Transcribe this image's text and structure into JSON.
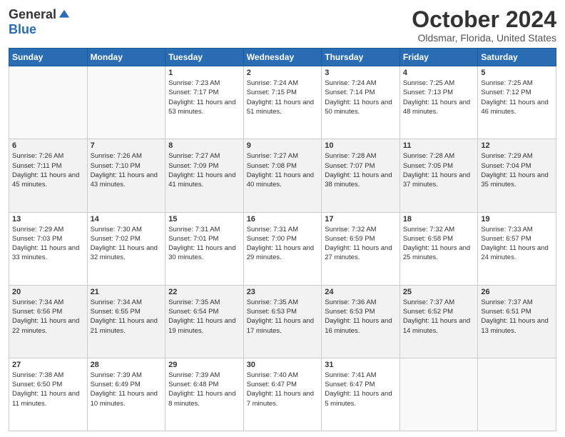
{
  "header": {
    "logo_general": "General",
    "logo_blue": "Blue",
    "month": "October 2024",
    "location": "Oldsmar, Florida, United States"
  },
  "days_of_week": [
    "Sunday",
    "Monday",
    "Tuesday",
    "Wednesday",
    "Thursday",
    "Friday",
    "Saturday"
  ],
  "weeks": [
    [
      {
        "day": "",
        "sunrise": "",
        "sunset": "",
        "daylight": ""
      },
      {
        "day": "",
        "sunrise": "",
        "sunset": "",
        "daylight": ""
      },
      {
        "day": "1",
        "sunrise": "Sunrise: 7:23 AM",
        "sunset": "Sunset: 7:17 PM",
        "daylight": "Daylight: 11 hours and 53 minutes."
      },
      {
        "day": "2",
        "sunrise": "Sunrise: 7:24 AM",
        "sunset": "Sunset: 7:15 PM",
        "daylight": "Daylight: 11 hours and 51 minutes."
      },
      {
        "day": "3",
        "sunrise": "Sunrise: 7:24 AM",
        "sunset": "Sunset: 7:14 PM",
        "daylight": "Daylight: 11 hours and 50 minutes."
      },
      {
        "day": "4",
        "sunrise": "Sunrise: 7:25 AM",
        "sunset": "Sunset: 7:13 PM",
        "daylight": "Daylight: 11 hours and 48 minutes."
      },
      {
        "day": "5",
        "sunrise": "Sunrise: 7:25 AM",
        "sunset": "Sunset: 7:12 PM",
        "daylight": "Daylight: 11 hours and 46 minutes."
      }
    ],
    [
      {
        "day": "6",
        "sunrise": "Sunrise: 7:26 AM",
        "sunset": "Sunset: 7:11 PM",
        "daylight": "Daylight: 11 hours and 45 minutes."
      },
      {
        "day": "7",
        "sunrise": "Sunrise: 7:26 AM",
        "sunset": "Sunset: 7:10 PM",
        "daylight": "Daylight: 11 hours and 43 minutes."
      },
      {
        "day": "8",
        "sunrise": "Sunrise: 7:27 AM",
        "sunset": "Sunset: 7:09 PM",
        "daylight": "Daylight: 11 hours and 41 minutes."
      },
      {
        "day": "9",
        "sunrise": "Sunrise: 7:27 AM",
        "sunset": "Sunset: 7:08 PM",
        "daylight": "Daylight: 11 hours and 40 minutes."
      },
      {
        "day": "10",
        "sunrise": "Sunrise: 7:28 AM",
        "sunset": "Sunset: 7:07 PM",
        "daylight": "Daylight: 11 hours and 38 minutes."
      },
      {
        "day": "11",
        "sunrise": "Sunrise: 7:28 AM",
        "sunset": "Sunset: 7:05 PM",
        "daylight": "Daylight: 11 hours and 37 minutes."
      },
      {
        "day": "12",
        "sunrise": "Sunrise: 7:29 AM",
        "sunset": "Sunset: 7:04 PM",
        "daylight": "Daylight: 11 hours and 35 minutes."
      }
    ],
    [
      {
        "day": "13",
        "sunrise": "Sunrise: 7:29 AM",
        "sunset": "Sunset: 7:03 PM",
        "daylight": "Daylight: 11 hours and 33 minutes."
      },
      {
        "day": "14",
        "sunrise": "Sunrise: 7:30 AM",
        "sunset": "Sunset: 7:02 PM",
        "daylight": "Daylight: 11 hours and 32 minutes."
      },
      {
        "day": "15",
        "sunrise": "Sunrise: 7:31 AM",
        "sunset": "Sunset: 7:01 PM",
        "daylight": "Daylight: 11 hours and 30 minutes."
      },
      {
        "day": "16",
        "sunrise": "Sunrise: 7:31 AM",
        "sunset": "Sunset: 7:00 PM",
        "daylight": "Daylight: 11 hours and 29 minutes."
      },
      {
        "day": "17",
        "sunrise": "Sunrise: 7:32 AM",
        "sunset": "Sunset: 6:59 PM",
        "daylight": "Daylight: 11 hours and 27 minutes."
      },
      {
        "day": "18",
        "sunrise": "Sunrise: 7:32 AM",
        "sunset": "Sunset: 6:58 PM",
        "daylight": "Daylight: 11 hours and 25 minutes."
      },
      {
        "day": "19",
        "sunrise": "Sunrise: 7:33 AM",
        "sunset": "Sunset: 6:57 PM",
        "daylight": "Daylight: 11 hours and 24 minutes."
      }
    ],
    [
      {
        "day": "20",
        "sunrise": "Sunrise: 7:34 AM",
        "sunset": "Sunset: 6:56 PM",
        "daylight": "Daylight: 11 hours and 22 minutes."
      },
      {
        "day": "21",
        "sunrise": "Sunrise: 7:34 AM",
        "sunset": "Sunset: 6:55 PM",
        "daylight": "Daylight: 11 hours and 21 minutes."
      },
      {
        "day": "22",
        "sunrise": "Sunrise: 7:35 AM",
        "sunset": "Sunset: 6:54 PM",
        "daylight": "Daylight: 11 hours and 19 minutes."
      },
      {
        "day": "23",
        "sunrise": "Sunrise: 7:35 AM",
        "sunset": "Sunset: 6:53 PM",
        "daylight": "Daylight: 11 hours and 17 minutes."
      },
      {
        "day": "24",
        "sunrise": "Sunrise: 7:36 AM",
        "sunset": "Sunset: 6:53 PM",
        "daylight": "Daylight: 11 hours and 16 minutes."
      },
      {
        "day": "25",
        "sunrise": "Sunrise: 7:37 AM",
        "sunset": "Sunset: 6:52 PM",
        "daylight": "Daylight: 11 hours and 14 minutes."
      },
      {
        "day": "26",
        "sunrise": "Sunrise: 7:37 AM",
        "sunset": "Sunset: 6:51 PM",
        "daylight": "Daylight: 11 hours and 13 minutes."
      }
    ],
    [
      {
        "day": "27",
        "sunrise": "Sunrise: 7:38 AM",
        "sunset": "Sunset: 6:50 PM",
        "daylight": "Daylight: 11 hours and 11 minutes."
      },
      {
        "day": "28",
        "sunrise": "Sunrise: 7:39 AM",
        "sunset": "Sunset: 6:49 PM",
        "daylight": "Daylight: 11 hours and 10 minutes."
      },
      {
        "day": "29",
        "sunrise": "Sunrise: 7:39 AM",
        "sunset": "Sunset: 6:48 PM",
        "daylight": "Daylight: 11 hours and 8 minutes."
      },
      {
        "day": "30",
        "sunrise": "Sunrise: 7:40 AM",
        "sunset": "Sunset: 6:47 PM",
        "daylight": "Daylight: 11 hours and 7 minutes."
      },
      {
        "day": "31",
        "sunrise": "Sunrise: 7:41 AM",
        "sunset": "Sunset: 6:47 PM",
        "daylight": "Daylight: 11 hours and 5 minutes."
      },
      {
        "day": "",
        "sunrise": "",
        "sunset": "",
        "daylight": ""
      },
      {
        "day": "",
        "sunrise": "",
        "sunset": "",
        "daylight": ""
      }
    ]
  ]
}
